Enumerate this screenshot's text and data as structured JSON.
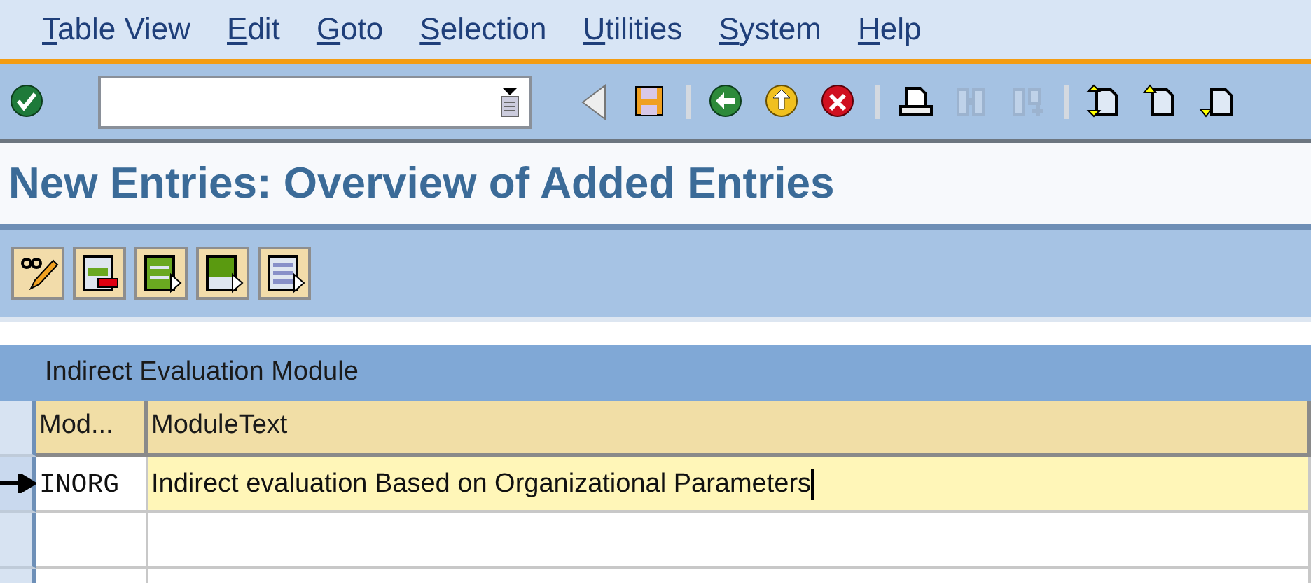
{
  "menu": [
    "Table View",
    "Edit",
    "Goto",
    "Selection",
    "Utilities",
    "System",
    "Help"
  ],
  "toolbar": [
    {
      "kind": "enter",
      "disabled": false
    },
    {
      "kind": "command-field"
    },
    {
      "kind": "back-triangle",
      "disabled": false
    },
    {
      "kind": "save",
      "disabled": false
    },
    {
      "kind": "sep"
    },
    {
      "kind": "back",
      "disabled": false
    },
    {
      "kind": "exit",
      "disabled": false
    },
    {
      "kind": "cancel",
      "disabled": false
    },
    {
      "kind": "sep"
    },
    {
      "kind": "print",
      "disabled": false
    },
    {
      "kind": "find",
      "disabled": true
    },
    {
      "kind": "find-next",
      "disabled": true
    },
    {
      "kind": "sep"
    },
    {
      "kind": "page-both",
      "disabled": false
    },
    {
      "kind": "page-up",
      "disabled": false
    },
    {
      "kind": "page-down",
      "disabled": false
    }
  ],
  "title": "New Entries: Overview of Added Entries",
  "app_toolbar": [
    {
      "kind": "display-change"
    },
    {
      "kind": "delete"
    },
    {
      "kind": "select-all"
    },
    {
      "kind": "select-block"
    },
    {
      "kind": "deselect-all"
    }
  ],
  "table": {
    "title": "Indirect Evaluation Module",
    "columns": [
      "Mod...",
      "ModuleText"
    ],
    "rows": [
      {
        "current": true,
        "cells": [
          "INORG",
          "Indirect evaluation Based on Organizational Parameters"
        ],
        "cursor": true
      },
      {
        "current": false
      },
      {
        "current": false
      }
    ]
  }
}
